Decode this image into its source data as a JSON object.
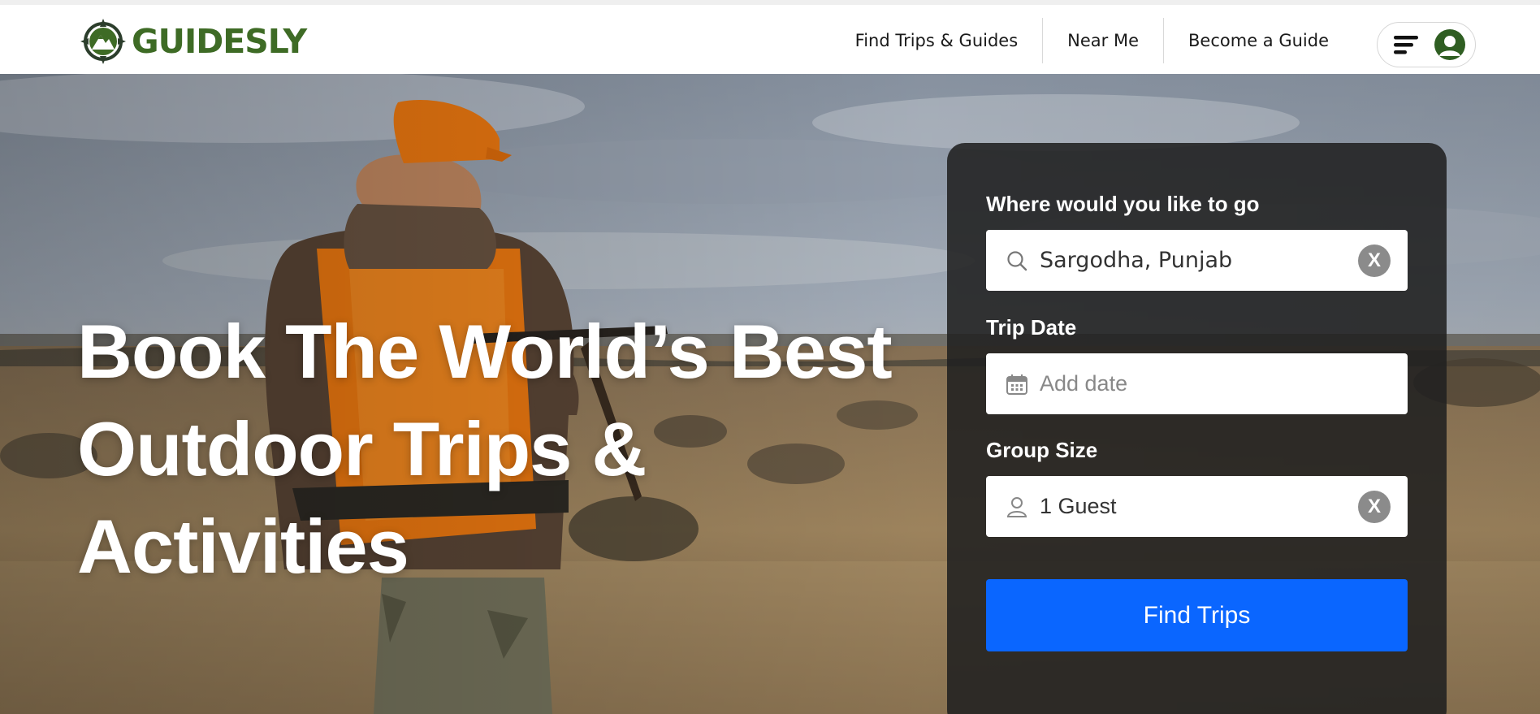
{
  "brand": {
    "name": "GUIDESLY",
    "color": "#3e6b25"
  },
  "nav": {
    "find_trips": "Find Trips & Guides",
    "near_me": "Near Me",
    "become_guide": "Become a Guide"
  },
  "hero": {
    "title_line1": "Book The World’s Best",
    "title_line2": "Outdoor Trips &",
    "title_line3": "Activities"
  },
  "search": {
    "destination_label": "Where would you like to go",
    "destination_value": "Sargodha, Punjab",
    "date_label": "Trip Date",
    "date_placeholder": "Add date",
    "group_label": "Group Size",
    "group_value": "1 Guest",
    "clear_label": "X",
    "submit_label": "Find Trips",
    "accent": "#0a66ff"
  }
}
